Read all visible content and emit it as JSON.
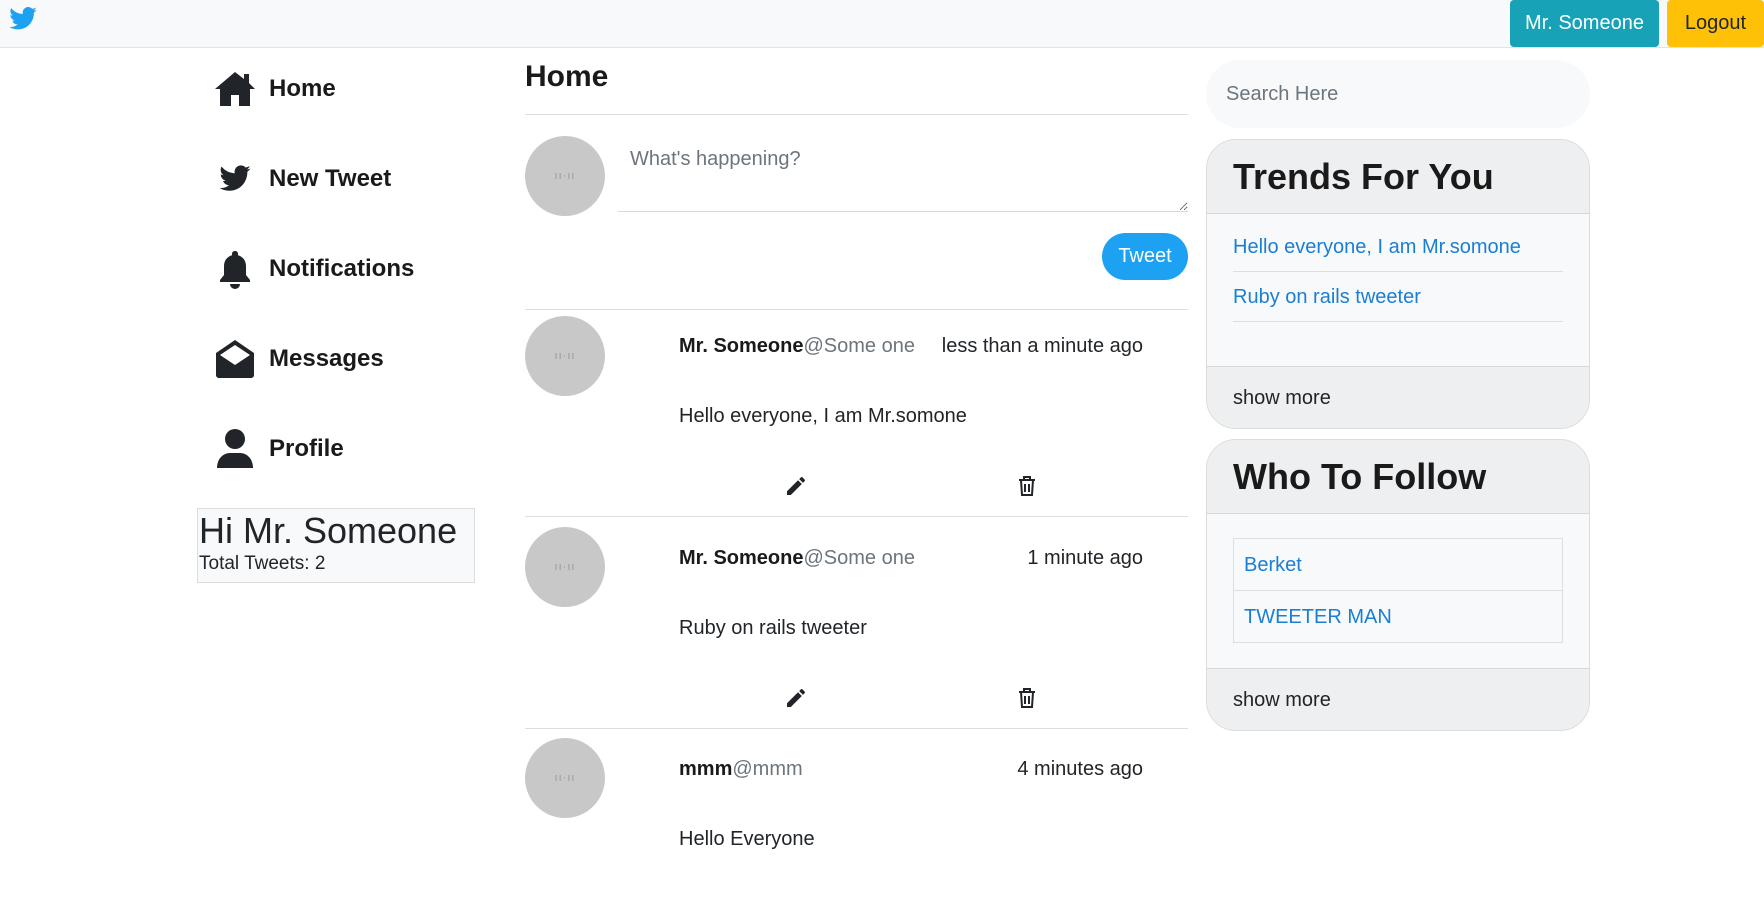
{
  "topbar": {
    "user_button": "Mr. Someone",
    "logout_button": "Logout",
    "brand_color": "#1da1f2"
  },
  "nav": {
    "items": [
      {
        "label": "Home",
        "icon": "home-icon"
      },
      {
        "label": "New Tweet",
        "icon": "bird-icon"
      },
      {
        "label": "Notifications",
        "icon": "bell-icon"
      },
      {
        "label": "Messages",
        "icon": "envelope-open-icon"
      },
      {
        "label": "Profile",
        "icon": "user-icon"
      }
    ]
  },
  "greeting": {
    "title": "Hi Mr. Someone",
    "subtitle": "Total Tweets: 2"
  },
  "main": {
    "title": "Home",
    "compose_placeholder": "What's happening?",
    "tweet_button": "Tweet",
    "tweets": [
      {
        "name": "Mr. Someone",
        "handle": "@Some one",
        "time": "less than a minute ago",
        "body": "Hello everyone, I am Mr.somone"
      },
      {
        "name": "Mr. Someone",
        "handle": "@Some one",
        "time": "1 minute ago",
        "body": "Ruby on rails tweeter"
      },
      {
        "name": "mmm",
        "handle": "@mmm",
        "time": "4 minutes ago",
        "body": "Hello Everyone"
      }
    ]
  },
  "sidebar": {
    "search_placeholder": "Search Here",
    "trends": {
      "title": "Trends For You",
      "items": [
        "Hello everyone, I am Mr.somone",
        "Ruby on rails tweeter"
      ],
      "more": "show more"
    },
    "follow": {
      "title": "Who To Follow",
      "items": [
        "Berket",
        "TWEETER MAN"
      ],
      "more": "show more"
    }
  }
}
